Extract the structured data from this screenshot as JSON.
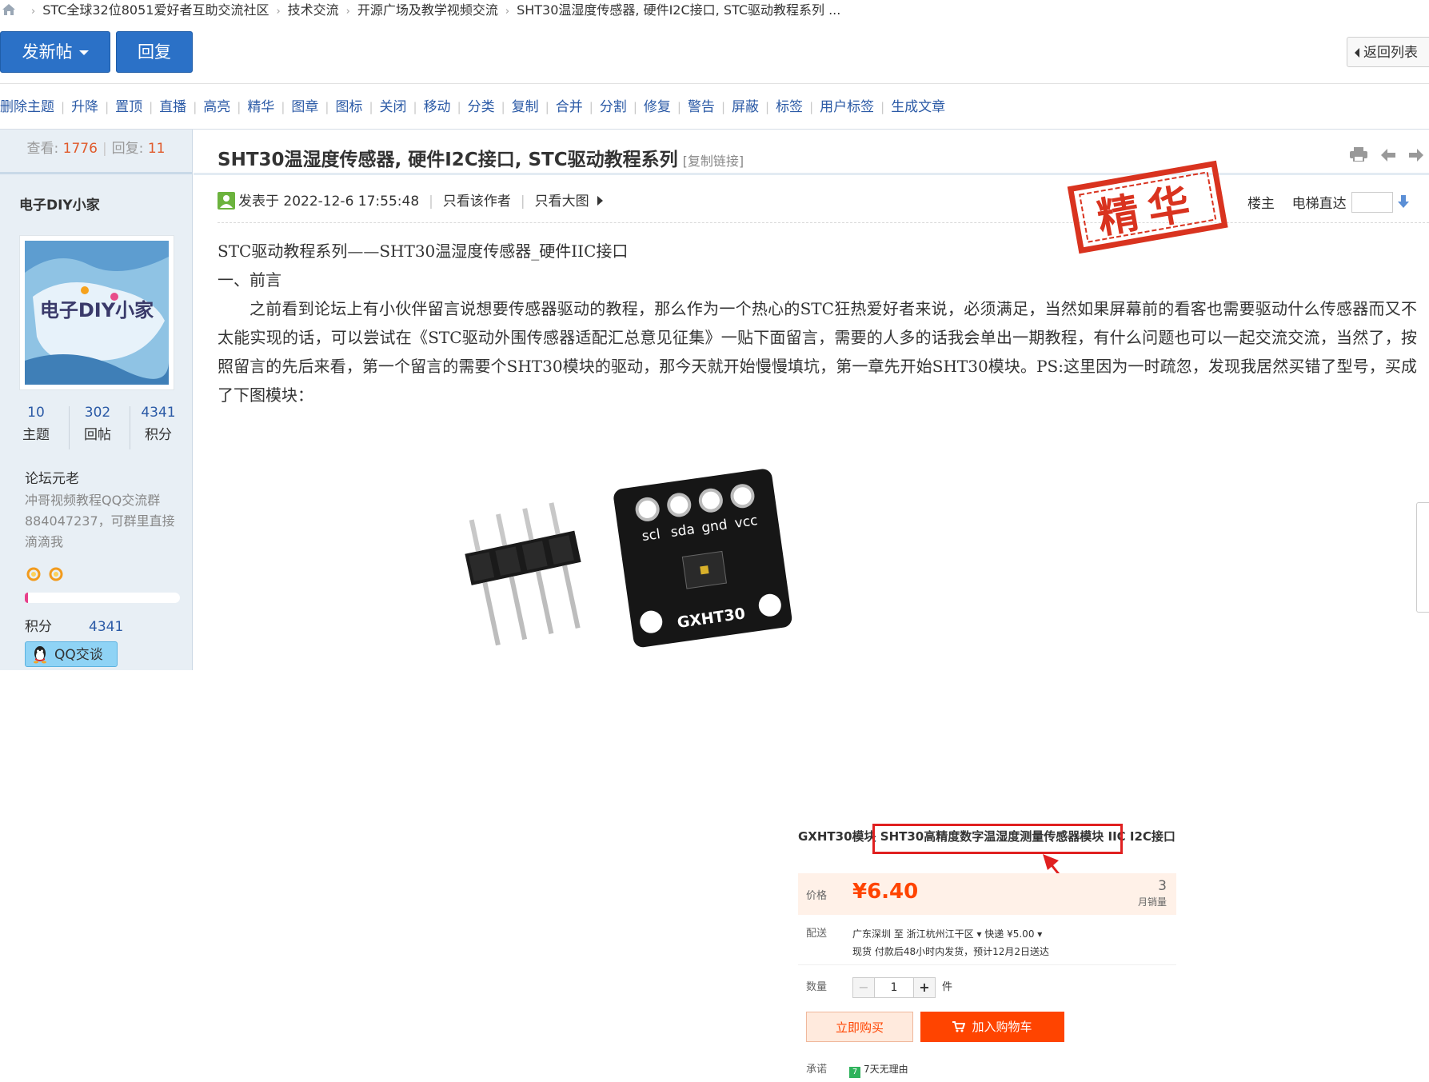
{
  "breadcrumb": {
    "items": [
      "STC全球32位8051爱好者互助交流社区",
      "技术交流",
      "开源广场及教学视频交流",
      "SHT30温湿度传感器, 硬件I2C接口, STC驱动教程系列 ..."
    ],
    "separator": "›"
  },
  "actions": {
    "new_post": "发新帖",
    "reply": "回复",
    "back_to_list": "返回列表"
  },
  "mod_tools": [
    "删除主题",
    "升降",
    "置顶",
    "直播",
    "高亮",
    "精华",
    "图章",
    "图标",
    "关闭",
    "移动",
    "分类",
    "复制",
    "合并",
    "分割",
    "修复",
    "警告",
    "屏蔽",
    "标签",
    "用户标签",
    "生成文章"
  ],
  "thread_stats": {
    "views_label": "查看:",
    "views": "1776",
    "replies_label": "回复:",
    "replies": "11"
  },
  "author": {
    "name": "电子DIY小家",
    "avatar_text": "电子DIY小家",
    "counts": [
      {
        "value": "10",
        "label": "主题"
      },
      {
        "value": "302",
        "label": "回帖"
      },
      {
        "value": "4341",
        "label": "积分"
      }
    ],
    "rank": "论坛元老",
    "signature": "冲哥视频教程QQ交流群884047237，可群里直接滴滴我",
    "level_progress": 0.02,
    "score_label": "积分",
    "score_value": "4341",
    "qq_button": "QQ交谈"
  },
  "post": {
    "title": "SHT30温湿度传感器, 硬件I2C接口, STC驱动教程系列",
    "copy_link": "[复制链接]",
    "posted_label": "发表于",
    "posted_at": "2022-12-6 17:55:48",
    "author_only": "只看该作者",
    "big_image": "只看大图",
    "floor": "楼主",
    "elevator": "电梯直达",
    "stamp_text": "精华",
    "heading": "STC驱动教程系列——SHT30温湿度传感器_硬件IIC接口",
    "section": "一、前言",
    "paragraph": "之前看到论坛上有小伙伴留言说想要传感器驱动的教程，那么作为一个热心的STC狂热爱好者来说，必须满足，当然如果屏幕前的看客也需要驱动什么传感器而又不太能实现的话，可以尝试在《STC驱动外围传感器适配汇总意见征集》一贴下面留言，需要的人多的话我会单出一期教程，有什么问题也可以一起交流交流，当然了，按照留言的先后来看，第一个留言的需要个SHT30模块的驱动，那今天就开始慢慢填坑，第一章先开始SHT30模块。PS:这里因为一时疏忽，发现我居然买错了型号，买成了下图模块："
  },
  "product_image": {
    "module_label": "GXHT30",
    "pin_labels": [
      "scl",
      "sda",
      "gnd",
      "vcc"
    ],
    "title_prefix": "GXHT30模块",
    "title_highlight": "SHT30高精度数字温湿度测量传感器模块",
    "title_suffix": "IIC I2C接口",
    "price_label": "价格",
    "price": "¥6.40",
    "sales_count": "3",
    "sales_label": "月销量",
    "ship_label": "配送",
    "ship_route": "广东深圳 至  浙江杭州江干区 ▾    快递 ¥5.00 ▾",
    "ship_note": "现货 付款后48小时内发货，预计12月2日送达",
    "qty_label": "数量",
    "qty_minus": "−",
    "qty_value": "1",
    "qty_plus": "+",
    "qty_unit": "件",
    "buy_now": "立即购买",
    "add_cart": "加入购物车",
    "promise_label": "承诺",
    "promise_icon": "7",
    "promise_value": "7天无理由"
  },
  "colors": {
    "primary_button": "#2b71c7",
    "link": "#2b5aa6",
    "stamp_red": "#d9331f",
    "price_orange": "#ff4400"
  }
}
